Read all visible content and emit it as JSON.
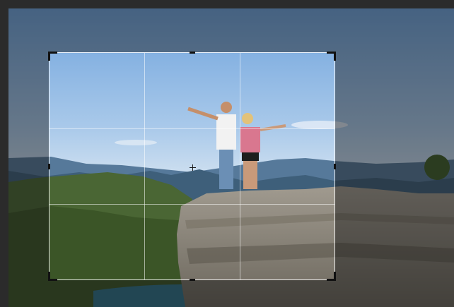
{
  "app": {
    "tool": "crop",
    "overlay": "rule-of-thirds"
  },
  "colors": {
    "frame": "#2b2b2b",
    "sky": "#7aaee0",
    "mountains": "#4f6f8c",
    "hills": "#3f5a2e",
    "rock": "#8a8378",
    "shade_overlay": "rgba(20,20,20,0.45)",
    "crop_border": "#ffffff",
    "handles": "#111111"
  },
  "icons": {
    "center": "crosshair-icon"
  }
}
